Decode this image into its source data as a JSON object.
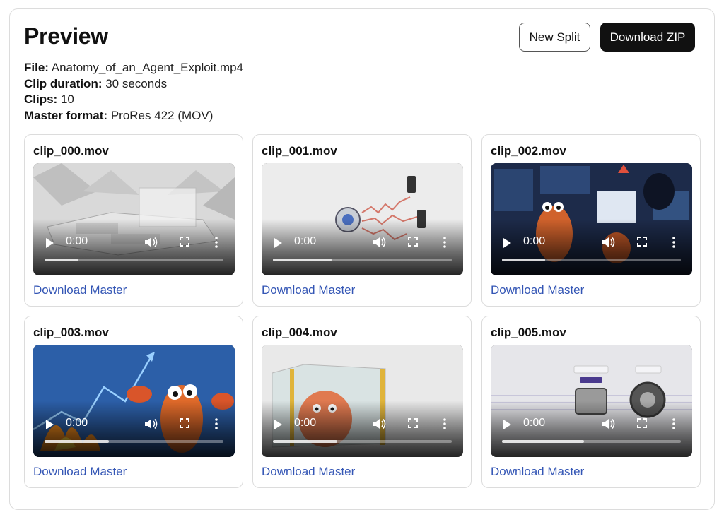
{
  "header": {
    "title": "Preview",
    "new_split_label": "New Split",
    "download_zip_label": "Download ZIP"
  },
  "meta": {
    "file_label": "File:",
    "file_value": "Anatomy_of_an_Agent_Exploit.mp4",
    "clip_duration_label": "Clip duration:",
    "clip_duration_value": "30 seconds",
    "clips_label": "Clips:",
    "clips_value": "10",
    "master_format_label": "Master format:",
    "master_format_value": "ProRes 422 (MOV)"
  },
  "clips": [
    {
      "name": "clip_000.mov",
      "time": "0:00",
      "buffered": 0.19,
      "download_label": "Download Master"
    },
    {
      "name": "clip_001.mov",
      "time": "0:00",
      "buffered": 0.33,
      "download_label": "Download Master"
    },
    {
      "name": "clip_002.mov",
      "time": "0:00",
      "buffered": 0.24,
      "download_label": "Download Master"
    },
    {
      "name": "clip_003.mov",
      "time": "0:00",
      "buffered": 0.36,
      "download_label": "Download Master"
    },
    {
      "name": "clip_004.mov",
      "time": "0:00",
      "buffered": 0.36,
      "download_label": "Download Master"
    },
    {
      "name": "clip_005.mov",
      "time": "0:00",
      "buffered": 0.46,
      "download_label": "Download Master"
    }
  ],
  "icons": {
    "play": "play-icon",
    "volume": "volume-icon",
    "fullscreen": "fullscreen-icon",
    "more": "more-options-icon"
  },
  "colors": {
    "link": "#3456b5",
    "primary_button": "#111111"
  }
}
